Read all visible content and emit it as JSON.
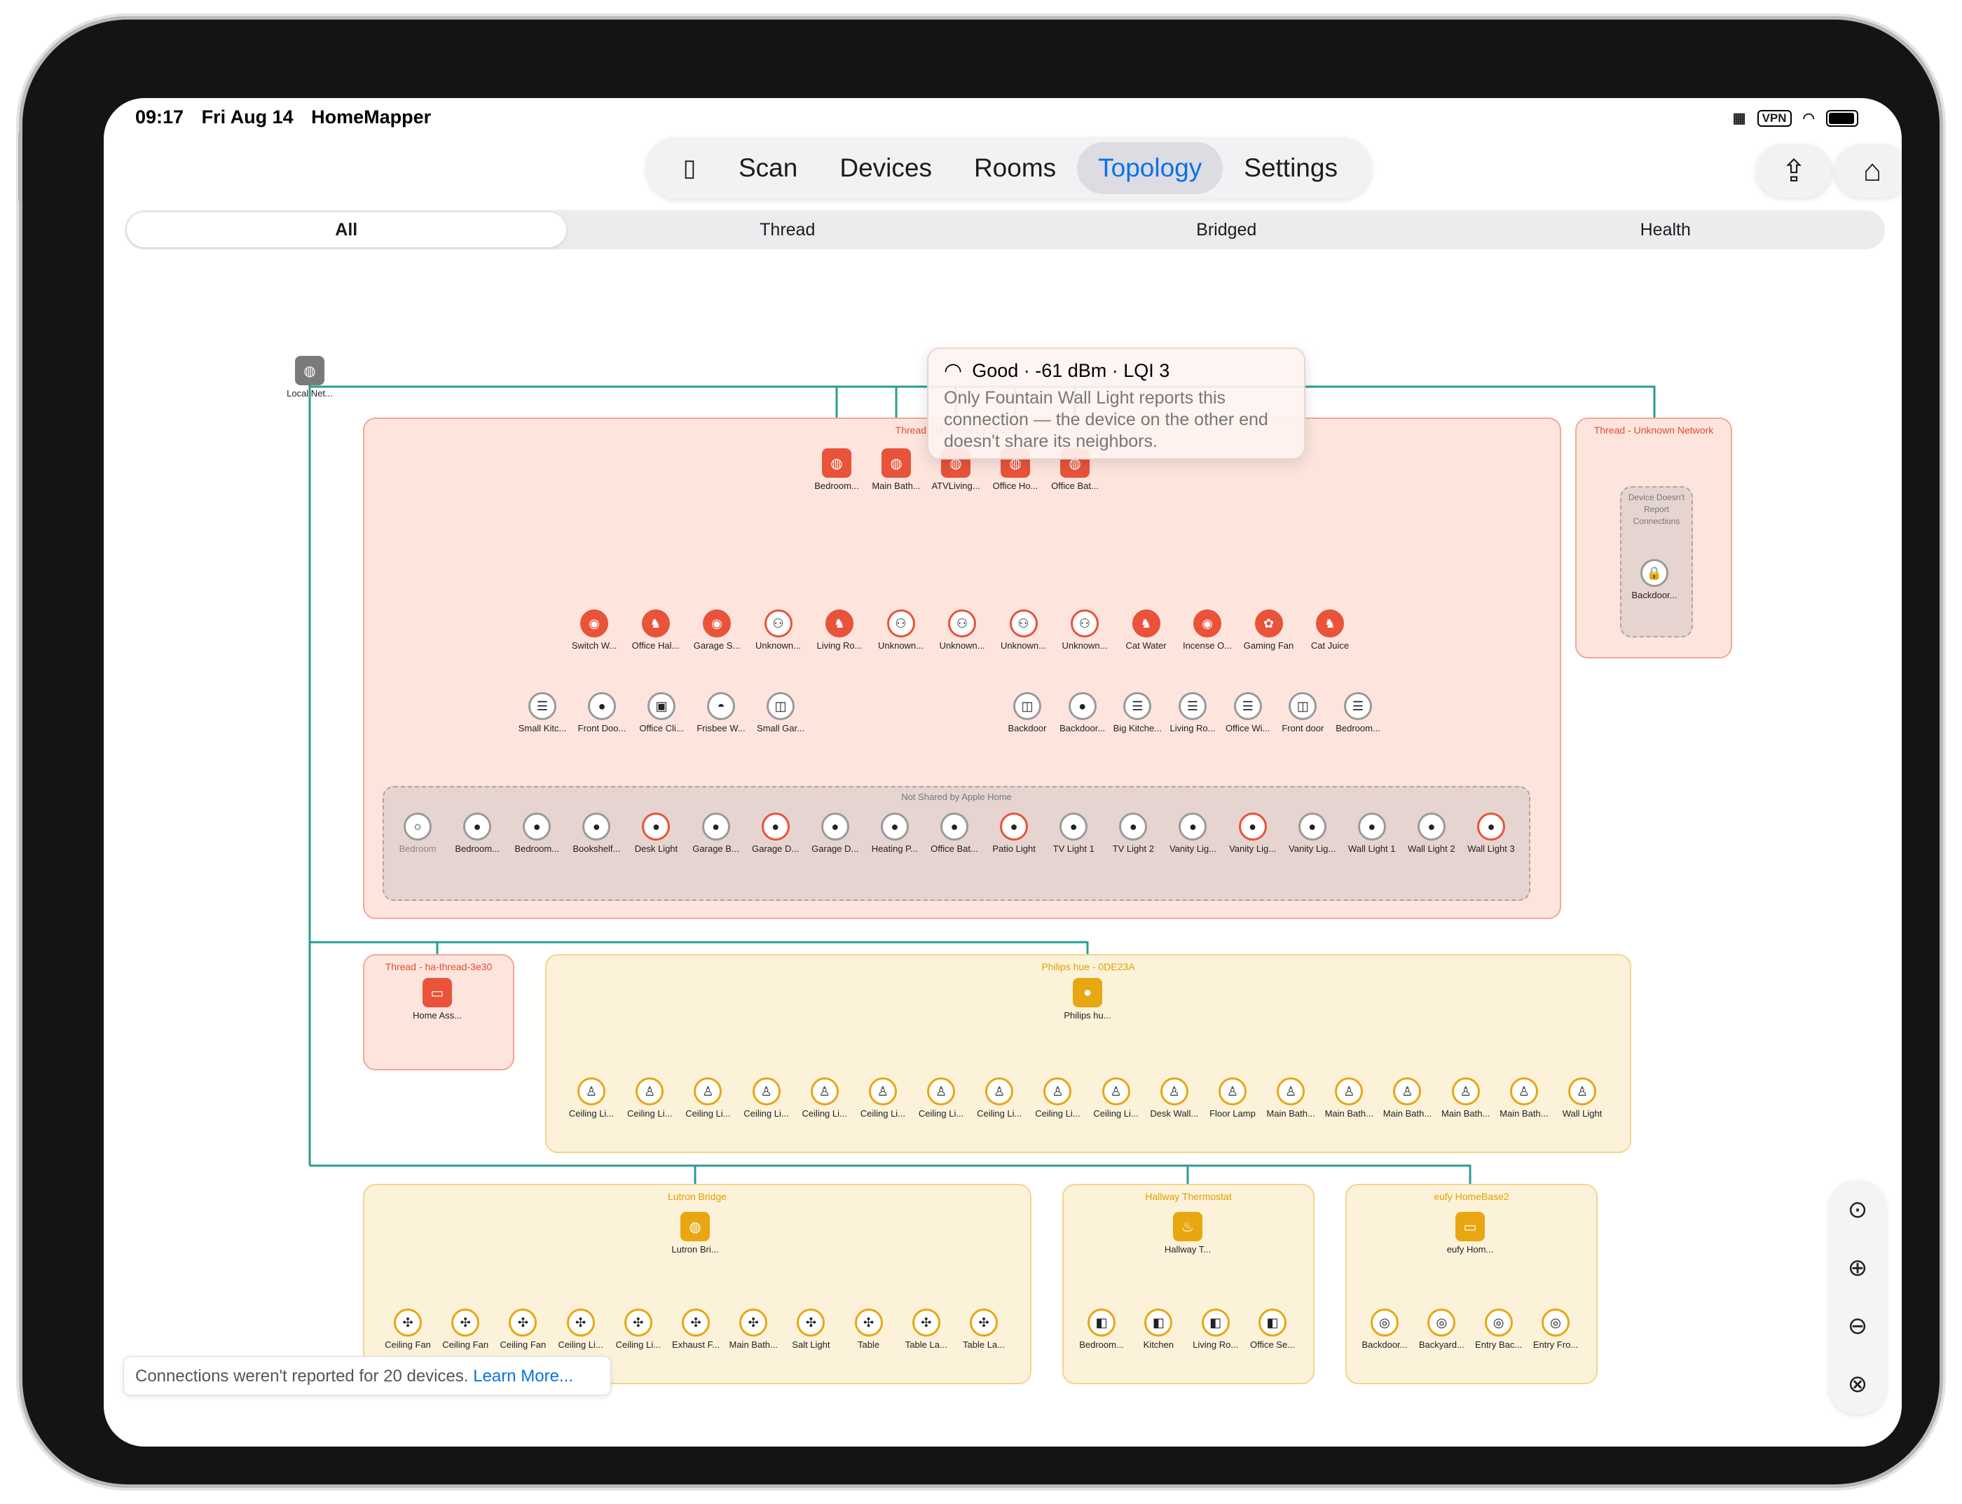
{
  "status": {
    "time": "09:17",
    "date": "Fri Aug 14",
    "app": "HomeMapper",
    "vpn": "VPN"
  },
  "nav": {
    "sidebar_icon": "sidebar-icon",
    "items": [
      {
        "label": "Scan",
        "active": false
      },
      {
        "label": "Devices",
        "active": false
      },
      {
        "label": "Rooms",
        "active": false
      },
      {
        "label": "Topology",
        "active": true
      },
      {
        "label": "Settings",
        "active": false
      }
    ],
    "share_icon": "share-icon",
    "home_icon": "home-icon"
  },
  "segments": [
    {
      "label": "All",
      "active": true
    },
    {
      "label": "Thread",
      "active": false
    },
    {
      "label": "Bridged",
      "active": false
    },
    {
      "label": "Health",
      "active": false
    }
  ],
  "colors": {
    "thread": "#e8533a",
    "bridge": "#e8a711",
    "ethernet": "#2a9d8f",
    "accent": "#0a72e8"
  },
  "topology": {
    "local_network": {
      "label": "Local Net..."
    },
    "thread_main": {
      "title": "Thread - MyHome1902826465",
      "border_routers": [
        "Bedroom...",
        "Main Bath...",
        "ATVLiving...",
        "Office Ho...",
        "Office Bat..."
      ],
      "routers": [
        "Switch W...",
        "Office Hal...",
        "Garage S...",
        "Unknown...",
        "Living Ro...",
        "Unknown...",
        "Unknown...",
        "Unknown...",
        "Unknown...",
        "Cat Water",
        "Incense O...",
        "Gaming Fan",
        "Cat Juice"
      ],
      "end_devices": [
        "Small Kitc...",
        "Front Doo...",
        "Office Cli...",
        "Frisbee W...",
        "Small Gar...",
        "Backdoor",
        "Backdoor...",
        "Big Kitche...",
        "Living Ro...",
        "Office Wi...",
        "Front door",
        "Bedroom..."
      ],
      "not_shared": {
        "title": "Not Shared by Apple Home",
        "devices": [
          "Bedroom",
          "Bedroom...",
          "Bedroom...",
          "Bookshelf...",
          "Desk Light",
          "Garage B...",
          "Garage D...",
          "Garage D...",
          "Heating P...",
          "Office Bat...",
          "Patio Light",
          "TV Light 1",
          "TV Light 2",
          "Vanity Lig...",
          "Vanity Lig...",
          "Vanity Lig...",
          "Wall Light 1",
          "Wall Light 2",
          "Wall Light 3"
        ]
      }
    },
    "thread_unknown": {
      "title": "Thread - Unknown Network",
      "note": "Device Doesn't Report Connections",
      "device": "Backdoor..."
    },
    "thread_ha": {
      "title": "Thread - ha-thread-3e30",
      "device": "Home Ass..."
    },
    "hue": {
      "title": "Philips hue - 0DE23A",
      "hub": "Philips hu...",
      "devices": [
        "Ceiling Li...",
        "Ceiling Li...",
        "Ceiling Li...",
        "Ceiling Li...",
        "Ceiling Li...",
        "Ceiling Li...",
        "Ceiling Li...",
        "Ceiling Li...",
        "Ceiling Li...",
        "Ceiling Li...",
        "Desk Wall...",
        "Floor Lamp",
        "Main Bath...",
        "Main Bath...",
        "Main Bath...",
        "Main Bath...",
        "Main Bath...",
        "Wall Light"
      ]
    },
    "lutron": {
      "title": "Lutron Bridge",
      "hub": "Lutron Bri...",
      "devices": [
        "Ceiling Fan",
        "Ceiling Fan",
        "Ceiling Fan",
        "Ceiling Li...",
        "Ceiling Li...",
        "Exhaust F...",
        "Main Bath...",
        "Salt Light",
        "Table",
        "Table La...",
        "Table La..."
      ]
    },
    "thermostat": {
      "title": "Hallway Thermostat",
      "hub": "Hallway T...",
      "devices": [
        "Bedroom...",
        "Kitchen",
        "Living Ro...",
        "Office Se..."
      ]
    },
    "eufy": {
      "title": "eufy HomeBase2",
      "hub": "eufy Hom...",
      "devices": [
        "Backdoor...",
        "Backyard...",
        "Entry Bac...",
        "Entry Fro..."
      ]
    }
  },
  "tooltip": {
    "signal": "Good · -61 dBm · LQI 3",
    "body": "Only Fountain Wall Light reports this connection — the device on the other end doesn't share its neighbors."
  },
  "zoom": [
    "zoom-reset-icon",
    "zoom-in-icon",
    "zoom-out-icon",
    "zoom-fit-icon"
  ],
  "banner": {
    "text": "Connections weren't reported for 20 devices.",
    "link": "Learn More..."
  }
}
